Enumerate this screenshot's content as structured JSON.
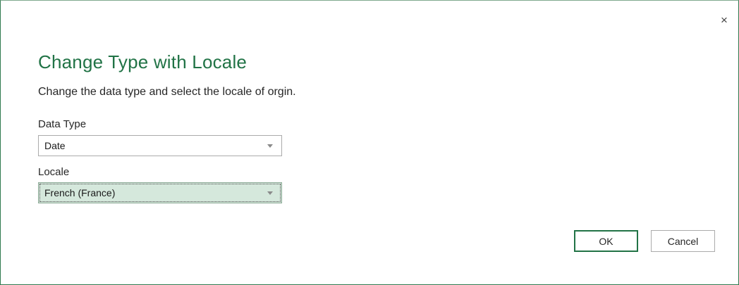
{
  "dialog": {
    "close_glyph": "×",
    "title": "Change Type with Locale",
    "description": "Change the data type and select the locale of orgin."
  },
  "data_type": {
    "label": "Data Type",
    "value": "Date"
  },
  "locale": {
    "label": "Locale",
    "value": "French (France)"
  },
  "buttons": {
    "ok": "OK",
    "cancel": "Cancel"
  },
  "colors": {
    "accent": "#217346",
    "focus_fill": "#d5e8dc"
  },
  "icons": {
    "close": "close-icon",
    "dropdown": "chevron-down-icon"
  }
}
